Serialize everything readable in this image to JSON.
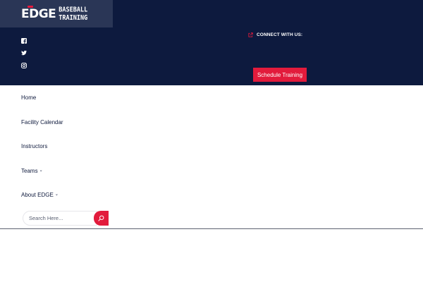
{
  "brand": {
    "logo_word": "EDGE",
    "logo_subtitle": "BASEBALL TRAINING"
  },
  "social": [
    {
      "icon": "facebook-icon"
    },
    {
      "icon": "twitter-icon"
    },
    {
      "icon": "instagram-icon"
    }
  ],
  "header": {
    "connect_label": "CONNECT WITH US:",
    "cta_label": "Schedule Training"
  },
  "nav": {
    "items": [
      {
        "label": "Home",
        "has_submenu": false
      },
      {
        "label": "Facility Calendar",
        "has_submenu": false
      },
      {
        "label": "Instructors",
        "has_submenu": false
      },
      {
        "label": "Teams",
        "has_submenu": true
      },
      {
        "label": "About EDGE",
        "has_submenu": true
      }
    ]
  },
  "search": {
    "placeholder": "Search Here..."
  },
  "colors": {
    "header_bg": "#0d1a3e",
    "logo_bg": "#2a3656",
    "accent": "#e21b3c",
    "nav_text": "#0f1a3d"
  }
}
